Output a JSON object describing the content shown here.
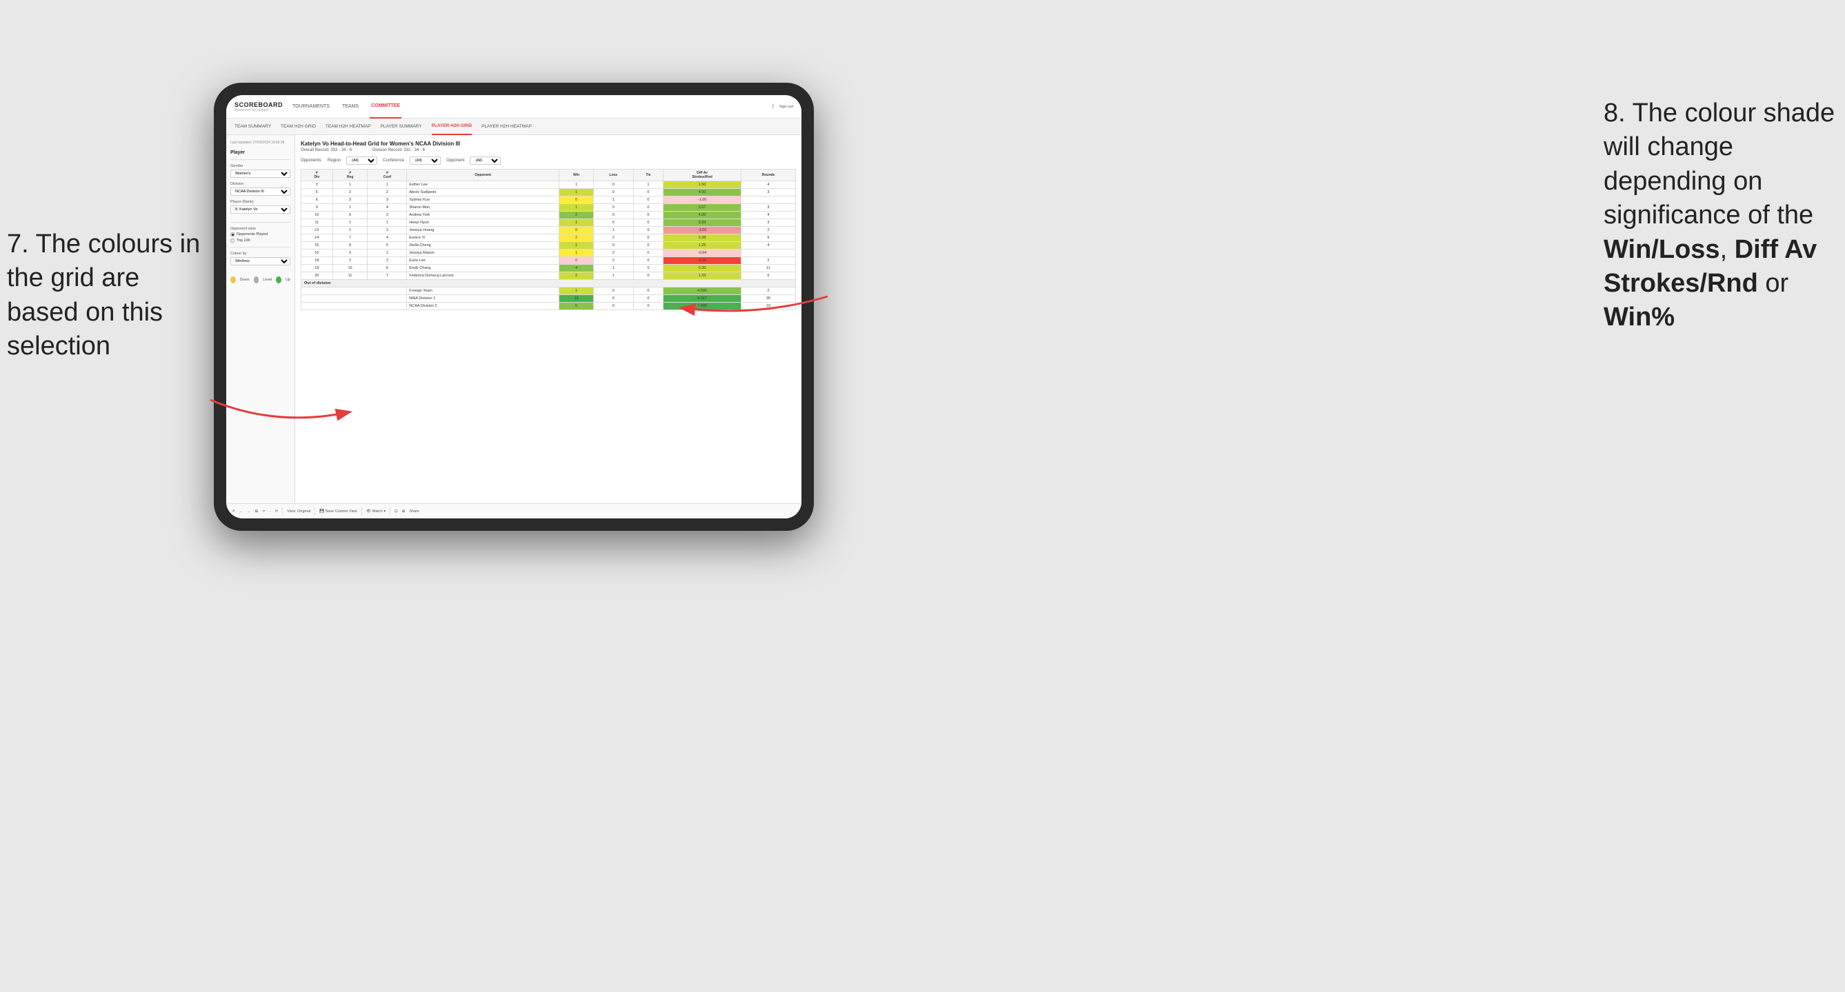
{
  "annotations": {
    "left_title": "7. The colours in the grid are based on this selection",
    "right_title": "8. The colour shade will change depending on significance of the",
    "right_bold1": "Win/Loss",
    "right_comma": ", ",
    "right_bold2": "Diff Av Strokes/Rnd",
    "right_or": " or",
    "right_bold3": "Win%"
  },
  "nav": {
    "logo": "SCOREBOARD",
    "logo_sub": "Powered by clippd",
    "items": [
      "TOURNAMENTS",
      "TEAMS",
      "COMMITTEE"
    ],
    "active_item": "COMMITTEE",
    "right_items": [
      "Sign out"
    ]
  },
  "sub_nav": {
    "items": [
      "TEAM SUMMARY",
      "TEAM H2H GRID",
      "TEAM H2H HEATMAP",
      "PLAYER SUMMARY",
      "PLAYER H2H GRID",
      "PLAYER H2H HEATMAP"
    ],
    "active_item": "PLAYER H2H GRID"
  },
  "sidebar": {
    "timestamp": "Last Updated: 27/03/2024 16:55:38",
    "section_title": "Player",
    "gender_label": "Gender",
    "gender_value": "Women's",
    "division_label": "Division",
    "division_value": "NCAA Division III",
    "player_rank_label": "Player (Rank)",
    "player_rank_value": "8. Katelyn Vo",
    "opponent_view_label": "Opponent view",
    "opponent_options": [
      "Opponents Played",
      "Top 100"
    ],
    "opponent_selected": "Opponents Played",
    "colour_by_label": "Colour by",
    "colour_by_value": "Win/loss",
    "legend": [
      {
        "color": "#e8c84a",
        "label": "Down"
      },
      {
        "color": "#aaaaaa",
        "label": "Level"
      },
      {
        "color": "#4caf50",
        "label": "Up"
      }
    ]
  },
  "main": {
    "title": "Katelyn Vo Head-to-Head Grid for Women's NCAA Division III",
    "overall_record_label": "Overall Record:",
    "overall_record_value": "353 - 34 - 6",
    "division_record_label": "Division Record:",
    "division_record_value": "331 - 34 - 6",
    "filters": {
      "opponents_label": "Opponents:",
      "region_label": "Region",
      "region_value": "(All)",
      "conference_label": "Conference",
      "conference_value": "(All)",
      "opponent_label": "Opponent",
      "opponent_value": "(All)"
    },
    "table_headers": {
      "div": "#\nDiv",
      "reg": "#\nReg",
      "conf": "#\nConf",
      "opponent": "Opponent",
      "win": "Win",
      "loss": "Loss",
      "tie": "Tie",
      "diff_av": "Diff Av\nStrokes/Rnd",
      "rounds": "Rounds"
    },
    "rows": [
      {
        "div": 3,
        "reg": 1,
        "conf": 1,
        "opponent": "Esther Lee",
        "win": 1,
        "loss": 0,
        "tie": 1,
        "diff": 1.5,
        "rounds": 4,
        "win_color": "white",
        "diff_color": "green-light"
      },
      {
        "div": 5,
        "reg": 2,
        "conf": 2,
        "opponent": "Alexis Sudijanto",
        "win": 1,
        "loss": 0,
        "tie": 0,
        "diff": 4.0,
        "rounds": 3,
        "win_color": "green-light",
        "diff_color": "green-mid"
      },
      {
        "div": 6,
        "reg": 3,
        "conf": 3,
        "opponent": "Sydney Kuo",
        "win": 0,
        "loss": 1,
        "tie": 0,
        "diff": -1.0,
        "rounds": "",
        "win_color": "yellow",
        "diff_color": "red-light"
      },
      {
        "div": 9,
        "reg": 1,
        "conf": 4,
        "opponent": "Sharon Mun",
        "win": 1,
        "loss": 0,
        "tie": 0,
        "diff": 3.67,
        "rounds": 3,
        "win_color": "green-light",
        "diff_color": "green-mid"
      },
      {
        "div": 10,
        "reg": 6,
        "conf": 3,
        "opponent": "Andrea York",
        "win": 2,
        "loss": 0,
        "tie": 0,
        "diff": 4.0,
        "rounds": 4,
        "win_color": "green-mid",
        "diff_color": "green-mid"
      },
      {
        "div": 11,
        "reg": 1,
        "conf": 1,
        "opponent": "Heejo Hyun",
        "win": 1,
        "loss": 0,
        "tie": 0,
        "diff": 3.33,
        "rounds": 3,
        "win_color": "green-light",
        "diff_color": "green-mid"
      },
      {
        "div": 13,
        "reg": 1,
        "conf": 1,
        "opponent": "Jessica Huang",
        "win": 0,
        "loss": 1,
        "tie": 0,
        "diff": -3.0,
        "rounds": 2,
        "win_color": "yellow",
        "diff_color": "red-mid"
      },
      {
        "div": 14,
        "reg": 7,
        "conf": 4,
        "opponent": "Eunice Yi",
        "win": 2,
        "loss": 2,
        "tie": 0,
        "diff": 0.38,
        "rounds": 9,
        "win_color": "yellow",
        "diff_color": "green-light"
      },
      {
        "div": 15,
        "reg": 8,
        "conf": 5,
        "opponent": "Stella Cheng",
        "win": 1,
        "loss": 0,
        "tie": 0,
        "diff": 1.25,
        "rounds": 4,
        "win_color": "green-light",
        "diff_color": "green-light"
      },
      {
        "div": 16,
        "reg": 9,
        "conf": 1,
        "opponent": "Jessica Mason",
        "win": 1,
        "loss": 2,
        "tie": 0,
        "diff": -0.94,
        "rounds": "",
        "win_color": "yellow",
        "diff_color": "red-light"
      },
      {
        "div": 18,
        "reg": 2,
        "conf": 2,
        "opponent": "Euna Lee",
        "win": 0,
        "loss": 2,
        "tie": 0,
        "diff": -5.0,
        "rounds": 2,
        "win_color": "red-light",
        "diff_color": "red-dark"
      },
      {
        "div": 19,
        "reg": 10,
        "conf": 6,
        "opponent": "Emily Chang",
        "win": 4,
        "loss": 1,
        "tie": 0,
        "diff": 0.3,
        "rounds": 11,
        "win_color": "green-mid",
        "diff_color": "green-light"
      },
      {
        "div": 20,
        "reg": 11,
        "conf": 7,
        "opponent": "Federica Domecq Lacroze",
        "win": 2,
        "loss": 1,
        "tie": 0,
        "diff": 1.33,
        "rounds": 6,
        "win_color": "green-light",
        "diff_color": "green-light"
      }
    ],
    "out_of_division": {
      "label": "Out of division",
      "rows": [
        {
          "opponent": "Foreign Team",
          "win": 1,
          "loss": 0,
          "tie": 0,
          "diff": 4.5,
          "rounds": 2,
          "win_color": "green-light",
          "diff_color": "green-mid"
        },
        {
          "opponent": "NAIA Division 1",
          "win": 15,
          "loss": 0,
          "tie": 0,
          "diff": 9.267,
          "rounds": 30,
          "win_color": "green-dark",
          "diff_color": "green-dark"
        },
        {
          "opponent": "NCAA Division 2",
          "win": 5,
          "loss": 0,
          "tie": 0,
          "diff": 7.4,
          "rounds": 10,
          "win_color": "green-mid",
          "diff_color": "green-dark"
        }
      ]
    }
  },
  "toolbar": {
    "items": [
      "↺",
      "←",
      "→",
      "⊞",
      "✂",
      "·",
      "⟳",
      "|",
      "View: Original",
      "|",
      "Save Custom View",
      "|",
      "Watch ▾",
      "|",
      "⊡",
      "⊞",
      "Share"
    ]
  }
}
